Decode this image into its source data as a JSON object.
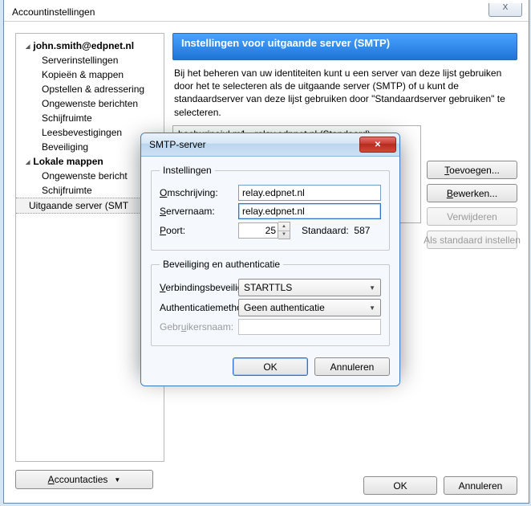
{
  "outer": {
    "title": "Accountinstellingen",
    "close_glyph": "X"
  },
  "tree": {
    "account": "john.smith@edpnet.nl",
    "items": [
      "Serverinstellingen",
      "Kopieën & mappen",
      "Opstellen & adressering",
      "Ongewenste berichten",
      "Schijfruimte",
      "Leesbevestigingen",
      "Beveiliging"
    ],
    "local_label": "Lokale mappen",
    "local_items": [
      "Ongewenste bericht",
      "Schijfruimte"
    ],
    "outgoing": "Uitgaande server (SMT",
    "accountacties_prefix": "A",
    "accountacties_rest": "ccountacties"
  },
  "panel": {
    "title": "Instellingen voor uitgaande server (SMTP)",
    "desc": "Bij het beheren van uw identiteiten kunt u een server van deze lijst gebruiken door het te selecteren als de uitgaande server (SMTP) of u kunt de standaardserver van deze lijst gebruiken door \"Standaardserver gebruiken\" te selecteren.",
    "list_item": "bachurinajul m1 - relay.edpnet.nl (Standaard)",
    "buttons": {
      "add_prefix": "T",
      "add_rest": "oevoegen...",
      "edit_prefix": "B",
      "edit_rest": "ewerken...",
      "remove": "Verwijderen",
      "default": "Als standaard instellen"
    }
  },
  "footer": {
    "ok": "OK",
    "cancel": "Annuleren"
  },
  "dialog": {
    "title": "SMTP-server",
    "legend1": "Instellingen",
    "desc_label_prefix": "O",
    "desc_label_rest": "mschrijving:",
    "desc_value": "relay.edpnet.nl",
    "server_label_prefix": "S",
    "server_label_rest": "ervernaam:",
    "server_value": "relay.edpnet.nl",
    "port_label_prefix": "P",
    "port_label_rest": "oort:",
    "port_value": "25",
    "std_label": "Standaard:",
    "std_value": "587",
    "legend2": "Beveiliging en authenticatie",
    "sec_label_prefix": "V",
    "sec_label_rest": "erbindingsbeveiliging:",
    "sec_value": "STARTTLS",
    "auth_label_rest1": "Authenticatiemetho",
    "auth_label_prefix": "d",
    "auth_label_rest2": "e:",
    "auth_value": "Geen authenticatie",
    "user_label_rest1": "Gebr",
    "user_label_prefix": "u",
    "user_label_rest2": "ikersnaam:",
    "ok": "OK",
    "cancel": "Annuleren"
  }
}
